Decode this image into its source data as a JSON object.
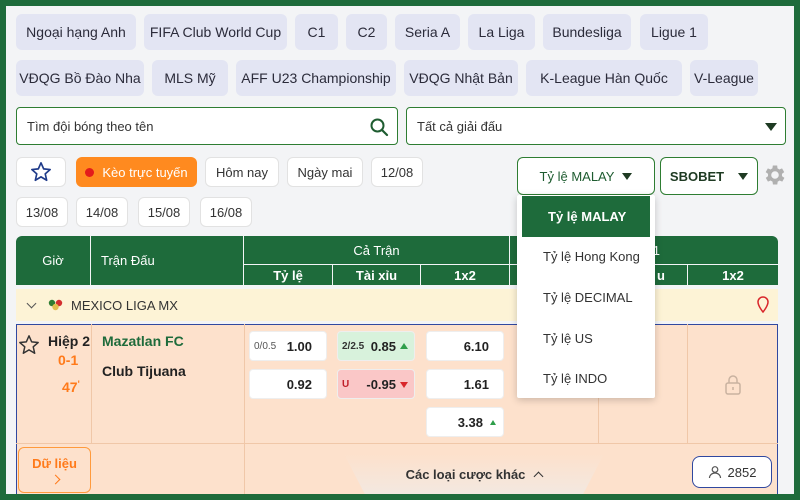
{
  "leagues_row1": [
    "Ngoại hạng Anh",
    "FIFA Club World Cup",
    "C1",
    "C2",
    "Seria A",
    "La Liga",
    "Bundesliga",
    "Ligue 1"
  ],
  "leagues_row2": [
    "VĐQG Bồ Đào Nha",
    "MLS Mỹ",
    "AFF U23 Championship",
    "VĐQG Nhật Bản",
    "K-League Hàn Quốc",
    "V-League"
  ],
  "search": {
    "placeholder": "Tìm đội bóng theo tên"
  },
  "league_select": {
    "value": "Tất cả giải đấu"
  },
  "filters": {
    "live_label": "Kèo trực tuyến",
    "today": "Hôm nay",
    "tomorrow": "Ngày mai",
    "dates": [
      "12/08",
      "13/08",
      "14/08",
      "15/08",
      "16/08"
    ]
  },
  "odds_type": {
    "selected": "Tỷ lệ MALAY",
    "options": [
      "Tỷ lệ MALAY",
      "Tỷ lệ Hong Kong",
      "Tỷ lệ DECIMAL",
      "Tỷ lệ US",
      "Tỷ lệ INDO"
    ]
  },
  "bookmaker": {
    "selected": "SBOBET"
  },
  "table": {
    "col_time": "Giờ",
    "col_match": "Trận Đấu",
    "group_full": "Cả Trận",
    "group_half_partial": "1",
    "sub_handicap": "Tỷ lệ",
    "sub_overunder": "Tài xỉu",
    "sub_1x2": "1x2",
    "sub_overunder_partial": "u",
    "sub_1x2_b": "1x2"
  },
  "league_row": {
    "name": "MEXICO LIGA MX"
  },
  "match": {
    "period": "Hiệp 2",
    "score": "0-1",
    "minute": "47",
    "home": "Mazatlan FC",
    "away": "Club Tijuana",
    "handicap_line": "0/0.5",
    "handicap_home": "1.00",
    "handicap_away": "0.92",
    "ou_line": "2/2.5",
    "ou_over": "0.85",
    "ou_under_label": "u",
    "ou_under": "-0.95",
    "x12_home": "6.10",
    "x12_away": "1.61",
    "x12_draw": "3.38",
    "more_bets": "Các loại cược khác",
    "data_label": "Dữ liệu",
    "viewers": "2852"
  },
  "colors": {
    "brand_green": "#1e6b3b",
    "live_orange": "#ff8a1f",
    "up_green": "#2e9e4a",
    "down_red": "#d9262b"
  }
}
